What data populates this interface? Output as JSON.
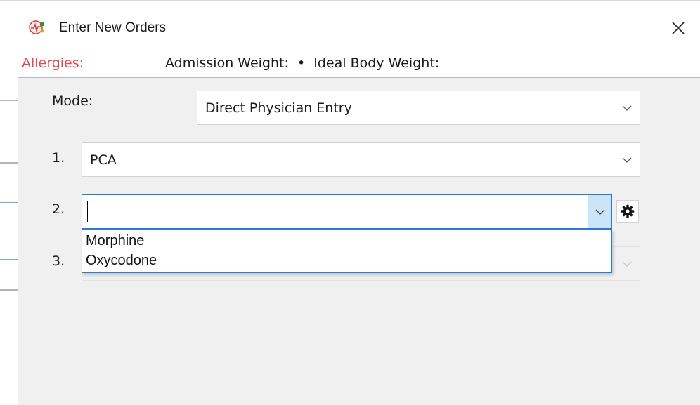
{
  "window": {
    "title": "Enter New Orders"
  },
  "info_bar": {
    "allergies_label": "Allergies:",
    "weights_text": "Admission Weight:  •  Ideal Body Weight:"
  },
  "form": {
    "mode": {
      "label": "Mode:",
      "value": "Direct Physician Entry"
    },
    "rows": [
      {
        "number": "1.",
        "value": "PCA"
      },
      {
        "number": "2.",
        "value": ""
      },
      {
        "number": "3.",
        "value": ""
      }
    ]
  },
  "dropdown": {
    "options": [
      "Morphine",
      "Oxycodone"
    ]
  },
  "icons": {
    "app": "medical-orders-app-icon",
    "close": "close-icon",
    "chevron": "chevron-down-icon",
    "settings": "gear-icon"
  },
  "colors": {
    "allergies_label": "#e8454f",
    "focus_border": "#2a7bd1",
    "dropdown_button_bg": "#cce4f7",
    "dialog_bg": "#f0f0f0"
  }
}
